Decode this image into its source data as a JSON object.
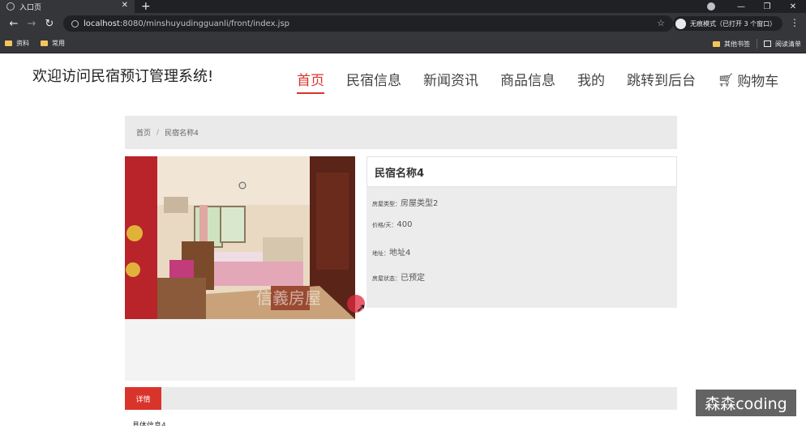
{
  "browser": {
    "tab_title": "入口页",
    "url_host": "localhost",
    "url_rest": ":8080/minshuyudingguanli/front/index.jsp",
    "incognito_label": "无痕模式（已打开 3 个窗口）",
    "bookmarks": [
      "资料",
      "常用"
    ],
    "bookmarks_right": [
      "其他书签",
      "阅读清单"
    ]
  },
  "header": {
    "site_title": "欢迎访问民宿预订管理系统!",
    "nav": [
      {
        "label": "首页",
        "active": true
      },
      {
        "label": "民宿信息"
      },
      {
        "label": "新闻资讯"
      },
      {
        "label": "商品信息"
      },
      {
        "label": "我的"
      },
      {
        "label": "跳转到后台"
      },
      {
        "label": "购物车",
        "icon": "cart-icon"
      }
    ]
  },
  "breadcrumb": {
    "home": "首页",
    "separator": "/",
    "current": "民宿名称4"
  },
  "detail": {
    "name": "民宿名称4",
    "fields": [
      {
        "label": "房屋类型：",
        "value": "房屋类型2"
      },
      {
        "label": "价格/天：",
        "value": "400"
      },
      {
        "label": "地址：",
        "value": "地址4"
      },
      {
        "label": "房屋状态：",
        "value": "已预定"
      }
    ]
  },
  "photo_watermark": "信義房屋",
  "tabs": {
    "detail_label": "详情"
  },
  "description_text": "具体信息4",
  "overlay_watermark": "森森coding",
  "colors": {
    "accent": "#d9342b",
    "chrome": "#35363a"
  }
}
